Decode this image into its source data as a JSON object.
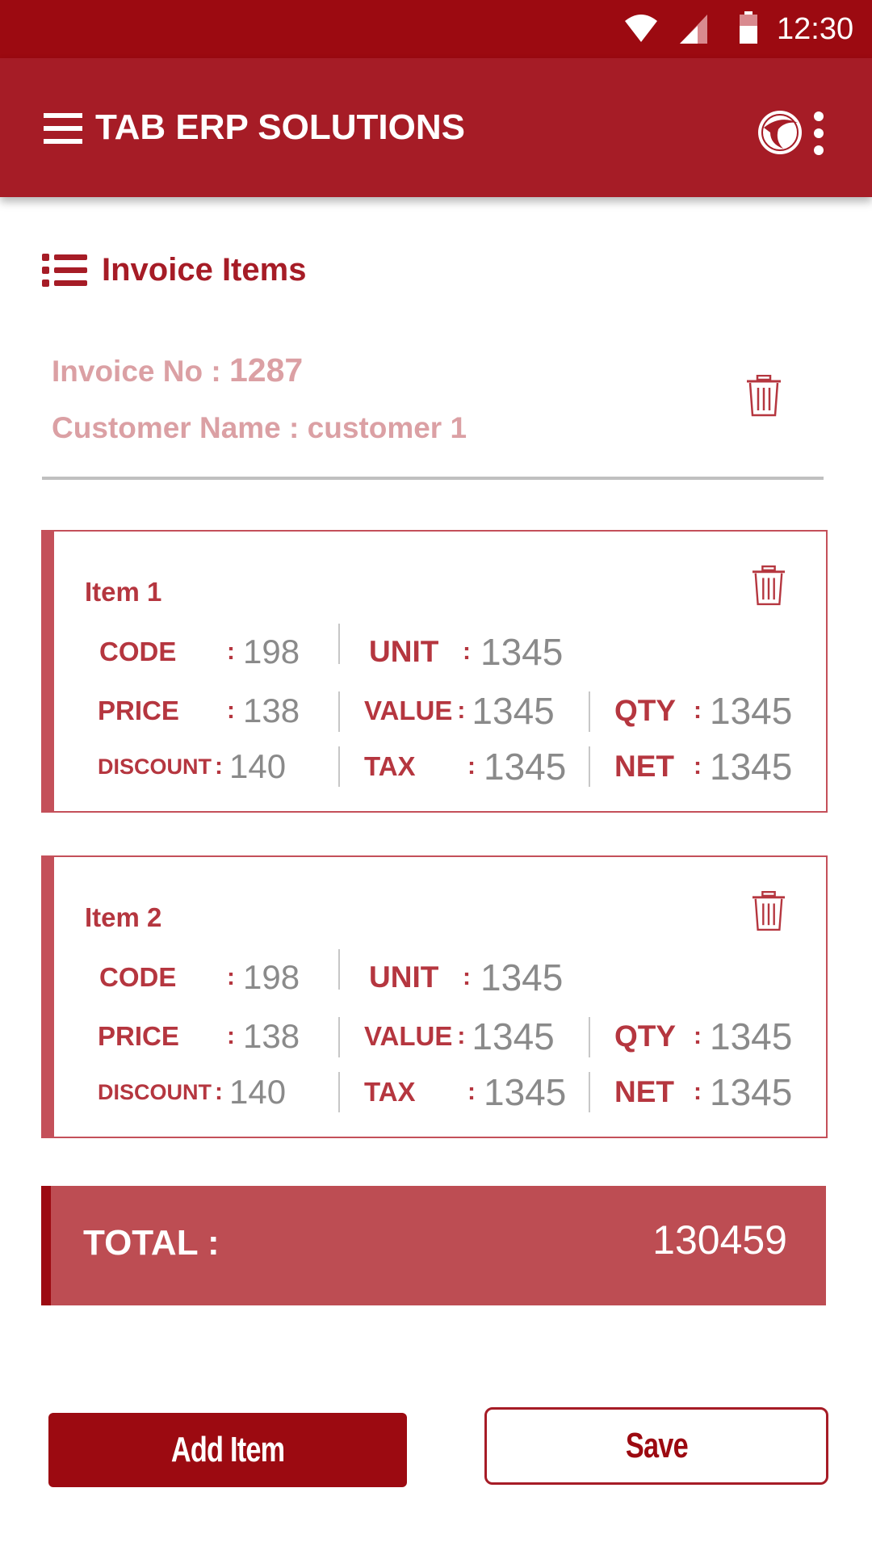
{
  "status_bar": {
    "time": "12:30"
  },
  "app_bar": {
    "title": "TAB ERP SOLUTIONS"
  },
  "section": {
    "title": "Invoice Items"
  },
  "invoice": {
    "number_label": "Invoice No : ",
    "number": "1287",
    "customer_label": "Customer Name : ",
    "customer": "customer 1"
  },
  "labels": {
    "code": "CODE",
    "unit": "UNIT",
    "price": "PRICE",
    "value": "VALUE",
    "qty": "QTY",
    "discount": "DISCOUNT",
    "tax": "TAX",
    "net": "NET",
    "separator": ":"
  },
  "items": [
    {
      "title": "Item 1",
      "code": "198",
      "unit": "1345",
      "price": "138",
      "value": "1345",
      "qty": "1345",
      "discount": "140",
      "tax": "1345",
      "net": "1345"
    },
    {
      "title": "Item 2",
      "code": "198",
      "unit": "1345",
      "price": "138",
      "value": "1345",
      "qty": "1345",
      "discount": "140",
      "tax": "1345",
      "net": "1345"
    }
  ],
  "total": {
    "label": "TOTAL :",
    "value": "130459"
  },
  "buttons": {
    "add_item": "Add Item",
    "save": "Save"
  },
  "colors": {
    "primary_dark": "#9c0a11",
    "primary": "#a61c26",
    "accent": "#bd4d53"
  }
}
